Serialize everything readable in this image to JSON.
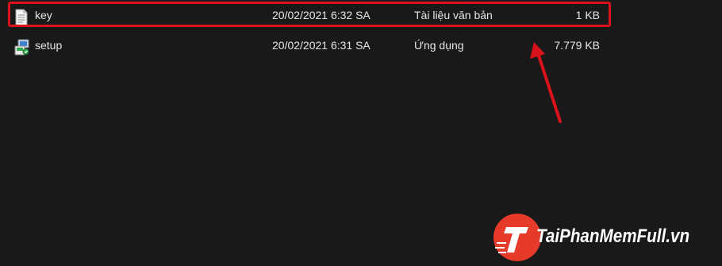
{
  "files": [
    {
      "name": "key",
      "icon": "text-document-icon",
      "date_modified": "20/02/2021 6:32 SA",
      "type": "Tài liệu văn bản",
      "size": "1 KB",
      "highlighted": true
    },
    {
      "name": "setup",
      "icon": "installer-icon",
      "date_modified": "20/02/2021 6:31 SA",
      "type": "Ứng dụng",
      "size": "7.779 KB",
      "highlighted": false
    }
  ],
  "annotation": {
    "highlight_color": "#d9121b",
    "arrow_color": "#d9121b"
  },
  "watermark": {
    "logo_letter": "T",
    "text": "TaiPhanMemFull.vn",
    "accent_color": "#e63a2b"
  },
  "colors": {
    "background": "#191919",
    "text": "#e6e6e6"
  }
}
